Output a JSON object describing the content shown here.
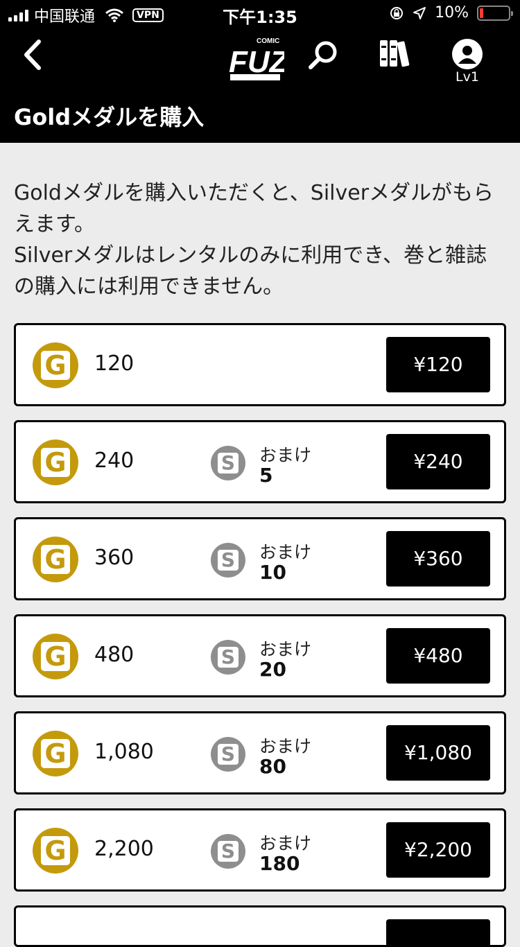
{
  "status": {
    "carrier": "中国联通",
    "vpn": "VPN",
    "time": "下午1:35",
    "battery": "10%"
  },
  "header": {
    "logo": "FUZ",
    "level": "Lv1",
    "title": "Goldメダルを購入"
  },
  "intro": {
    "line1": "Goldメダルを購入いただくと、Silverメダルがもらえます。",
    "line2": "Silverメダルはレンタルのみに利用でき、巻と雑誌の購入には利用できません。"
  },
  "bonus_label": "おまけ",
  "items": [
    {
      "amount": "120",
      "bonus": "",
      "price": "¥120"
    },
    {
      "amount": "240",
      "bonus": "5",
      "price": "¥240"
    },
    {
      "amount": "360",
      "bonus": "10",
      "price": "¥360"
    },
    {
      "amount": "480",
      "bonus": "20",
      "price": "¥480"
    },
    {
      "amount": "1,080",
      "bonus": "80",
      "price": "¥1,080"
    },
    {
      "amount": "2,200",
      "bonus": "180",
      "price": "¥2,200"
    }
  ],
  "colors": {
    "gold": "#c49a0c",
    "silver": "#8e8e8e",
    "header_bg": "#000000",
    "body_bg": "#ececec"
  }
}
